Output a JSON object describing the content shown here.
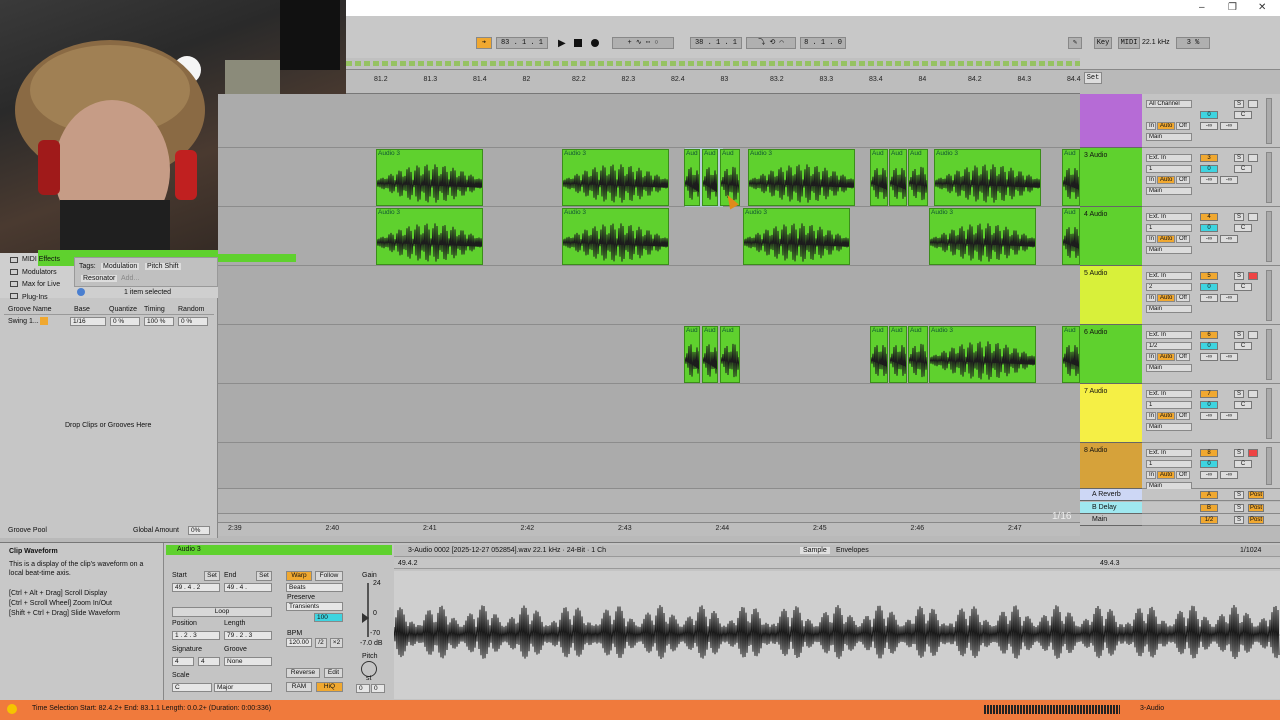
{
  "window_controls": {
    "minimize": "–",
    "maximize": "❐",
    "close": "✕"
  },
  "transport": {
    "tempo_position": "83 . 1 . 1",
    "loop_start": "38 . 1 . 1",
    "loop_length": "8 . 1 . 0",
    "key_label": "Key",
    "midi_label": "MIDI",
    "sample_rate": "22.1 kHz",
    "cpu": "3 %"
  },
  "ruler_ticks": [
    "81.2",
    "81.3",
    "81.4",
    "82",
    "82.2",
    "82.3",
    "82.4",
    "83",
    "83.2",
    "83.3",
    "83.4",
    "84",
    "84.2",
    "84.3",
    "84.4"
  ],
  "ruler_set": "Set",
  "bottom_ticks": [
    "2:39",
    "2:40",
    "2:41",
    "2:42",
    "2:43",
    "2:44",
    "2:45",
    "2:46",
    "2:47"
  ],
  "zoom_label": "1/16",
  "clip_name": "Audio 3",
  "clip_short": "Aud",
  "tracks": [
    {
      "name": "",
      "color": "#b66bd6",
      "input": "All Channel",
      "out": "Main",
      "num": "",
      "vol": "0",
      "pan": "C"
    },
    {
      "name": "3 Audio",
      "color": "#5fd12e",
      "input": "Ext. In",
      "ch": "1",
      "out": "Main",
      "num": "3",
      "vol": "0",
      "pan": "C"
    },
    {
      "name": "4 Audio",
      "color": "#5fd12e",
      "input": "Ext. In",
      "ch": "1",
      "out": "Main",
      "num": "4",
      "vol": "0",
      "pan": "C"
    },
    {
      "name": "5 Audio",
      "color": "#d8f03a",
      "input": "Ext. In",
      "ch": "2",
      "out": "Main",
      "num": "5",
      "vol": "0",
      "pan": "C"
    },
    {
      "name": "6 Audio",
      "color": "#5fd12e",
      "input": "Ext. In",
      "ch": "1/2",
      "out": "Main",
      "num": "6",
      "vol": "0",
      "pan": "C"
    },
    {
      "name": "7 Audio",
      "color": "#f5ef45",
      "input": "Ext. In",
      "ch": "1",
      "out": "Main",
      "num": "7",
      "vol": "0",
      "pan": "C"
    },
    {
      "name": "8 Audio",
      "color": "#d6a23a",
      "input": "Ext. In",
      "ch": "1",
      "out": "Main",
      "num": "8",
      "vol": "0",
      "pan": "C"
    }
  ],
  "returns": [
    {
      "name": "A Reverb",
      "letter": "A"
    },
    {
      "name": "B Delay",
      "letter": "B"
    },
    {
      "name": "Main",
      "letter": "1/2"
    }
  ],
  "mixer_labels": {
    "in": "In",
    "auto": "Auto",
    "off": "Off",
    "inf": "-∞",
    "s": "S",
    "post": "Post"
  },
  "browser": {
    "items": [
      "MIDI Effects",
      "Modulators",
      "Max for Live",
      "Plug-Ins"
    ],
    "tags_label": "Tags:",
    "tag1": "Modulation",
    "tag2": "Pitch Shift",
    "tag3": "Resonator",
    "tag_add": "Add...",
    "selected": "1 item selected",
    "groove_headers": [
      "Groove Name",
      "Base",
      "Quantize",
      "Timing",
      "Random"
    ],
    "groove_row": [
      "Swing 1...",
      "1/16",
      "0 %",
      "100 %",
      "0 %"
    ],
    "drop_hint": "Drop Clips or Grooves Here",
    "groove_pool": "Groove Pool",
    "global_amount_label": "Global Amount",
    "global_amount": "0%"
  },
  "info": {
    "title": "Clip Waveform",
    "body": "This is a display of the clip's waveform on a local beat-time axis.",
    "shortcuts": [
      "[Ctrl + Alt + Drag] Scroll Display",
      "[Ctrl + Scroll Wheel] Zoom In/Out",
      "[Shift + Ctrl + Drag] Slide Waveform"
    ]
  },
  "clip_view": {
    "name": "Audio 3",
    "start_label": "Start",
    "end_label": "End",
    "set_label": "Set",
    "start": "49 . 4 . 2",
    "end": "49 . 4 .",
    "loop": "Loop",
    "position_label": "Position",
    "length_label": "Length",
    "position": "1 . 2 . 3",
    "length": "79 . 2 . 3",
    "signature_label": "Signature",
    "sig_num": "4",
    "sig_den": "4",
    "groove_label": "Groove",
    "groove": "None",
    "scale_label": "Scale",
    "scale_root": "C",
    "scale_mode": "Major",
    "warp": "Warp",
    "follow": "Follow",
    "beats": "Beats",
    "preserve": "Preserve",
    "transients": "Transients",
    "grain": "100",
    "bpm_label": "BPM",
    "bpm": "120.00",
    "half": "/2",
    "double": "×2",
    "reverse": "Reverse",
    "edit": "Edit",
    "ram": "RAM",
    "hiq": "HiQ",
    "gain_label": "Gain",
    "gain_top": "24",
    "gain_zero": "0",
    "gain_bottom": "-70",
    "gain_value": "-7.0 dB",
    "pitch_label": "Pitch",
    "pitch_unit": "st",
    "pitch_semi": "0",
    "pitch_cent": "0",
    "file": "3-Audio 0002 [2025-12-27 052854].wav  22.1 kHz · 24-Bit · 1 Ch",
    "tab_sample": "Sample",
    "tab_envelopes": "Envelopes",
    "zoom": "1/1024",
    "pos_left": "49.4.2",
    "pos_right": "49.4.3"
  },
  "status": {
    "text": "Time Selection   Start: 82.4.2+   End: 83.1.1   Length: 0.0.2+  (Duration: 0:00:336)",
    "track": "3-Audio"
  }
}
